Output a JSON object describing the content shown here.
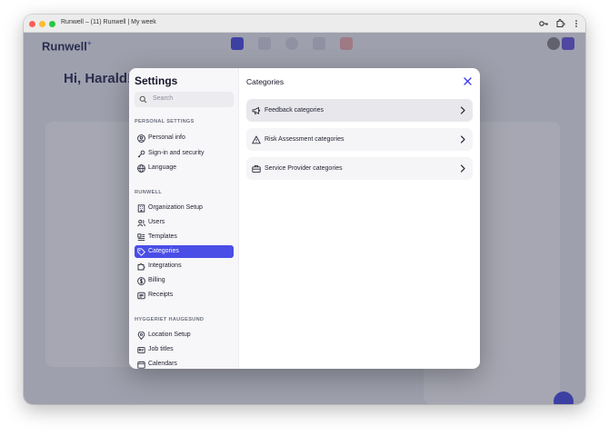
{
  "window": {
    "title": "Runwell – (11) Runwell | My week"
  },
  "app": {
    "logo": "Runwell",
    "greeting": "Hi, Harald!"
  },
  "settings": {
    "title": "Settings",
    "search_placeholder": "Search",
    "sections": [
      {
        "heading": "PERSONAL SETTINGS",
        "items": [
          {
            "label": "Personal info",
            "icon": "user-circle-icon"
          },
          {
            "label": "Sign-in and security",
            "icon": "key-icon"
          },
          {
            "label": "Language",
            "icon": "globe-icon"
          }
        ]
      },
      {
        "heading": "RUNWELL",
        "items": [
          {
            "label": "Organization Setup",
            "icon": "building-icon"
          },
          {
            "label": "Users",
            "icon": "users-icon"
          },
          {
            "label": "Templates",
            "icon": "template-icon"
          },
          {
            "label": "Categories",
            "icon": "tag-icon",
            "active": true
          },
          {
            "label": "Integrations",
            "icon": "puzzle-icon"
          },
          {
            "label": "Billing",
            "icon": "dollar-icon"
          },
          {
            "label": "Receipts",
            "icon": "receipt-icon"
          }
        ]
      },
      {
        "heading": "HYGGERIET HAUGESUND",
        "items": [
          {
            "label": "Location Setup",
            "icon": "location-pin-icon"
          },
          {
            "label": "Job titles",
            "icon": "id-badge-icon"
          },
          {
            "label": "Calendars",
            "icon": "calendar-icon"
          }
        ]
      }
    ]
  },
  "categories": {
    "title": "Categories",
    "items": [
      {
        "label": "Feedback categories",
        "icon": "megaphone-icon"
      },
      {
        "label": "Risk Assessment categories",
        "icon": "warning-icon"
      },
      {
        "label": "Service Provider categories",
        "icon": "briefcase-icon"
      }
    ]
  },
  "colors": {
    "accent": "#4a4ee6",
    "close": "#3d3df0"
  }
}
